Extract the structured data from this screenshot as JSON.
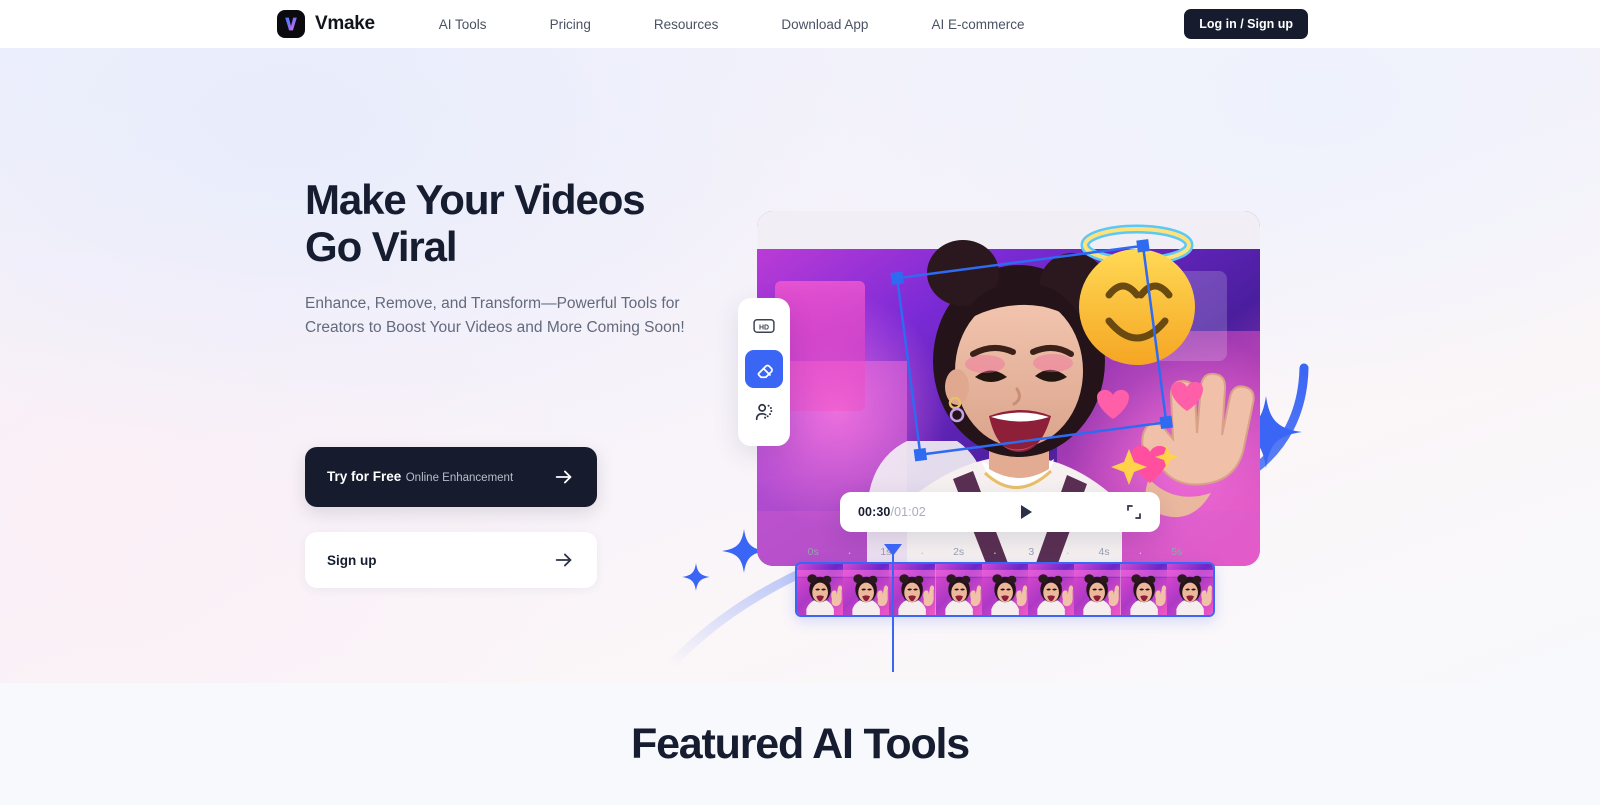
{
  "colors": {
    "accent_blue": "#3b66f5",
    "dark": "#161b2e",
    "muted_text": "#636a7c",
    "page_bg": "#f8f9fc"
  },
  "nav": {
    "brand": "Vmake",
    "logo_icon": "vmake-v-logo-icon",
    "links": [
      {
        "label": "AI Tools"
      },
      {
        "label": "Pricing"
      },
      {
        "label": "Resources"
      },
      {
        "label": "Download App"
      },
      {
        "label": "AI E-commerce"
      }
    ],
    "login_label": "Log in / Sign up"
  },
  "hero": {
    "headline": "Make Your Videos\nGo Viral",
    "subhead": "Enhance, Remove, and Transform—Powerful Tools for Creators to Boost Your Videos and More Coming Soon!",
    "cta_primary": {
      "title": "Try for Free",
      "subtitle": "Online Enhancement",
      "icon": "arrow-right-icon"
    },
    "cta_secondary": {
      "title": "Sign up",
      "icon": "arrow-right-icon"
    }
  },
  "editor": {
    "tools": [
      {
        "name": "hd-quality-tool",
        "icon": "hd-icon",
        "label": "HD",
        "active": false
      },
      {
        "name": "eraser-tool",
        "icon": "eraser-icon",
        "active": true
      },
      {
        "name": "remove-background-tool",
        "icon": "person-cutout-icon",
        "active": false
      }
    ],
    "player": {
      "current_time": "00:30",
      "separator": "/",
      "total_time": "01:02",
      "play_icon": "play-icon",
      "fullscreen_icon": "fullscreen-collapse-icon"
    },
    "timeline": {
      "ticks": [
        "0s",
        "·",
        "1s",
        "·",
        "2s",
        "·",
        "3",
        "·",
        "4s",
        "·",
        "5s"
      ],
      "playhead_position": "1s",
      "frame_count": 9
    }
  },
  "featured": {
    "title": "Featured AI Tools"
  }
}
